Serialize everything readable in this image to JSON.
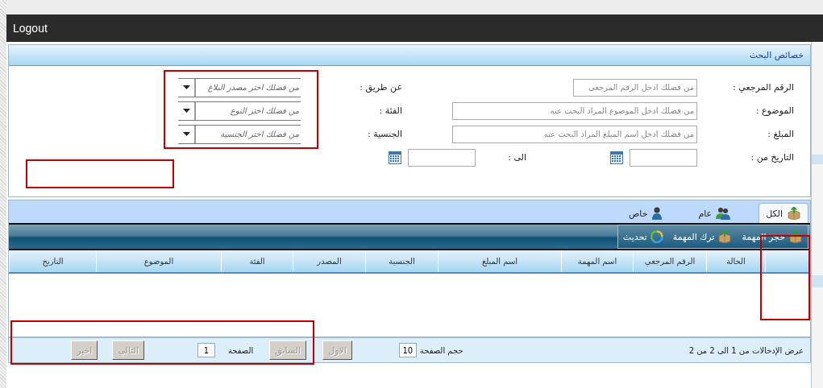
{
  "header": {
    "link": "Logout"
  },
  "search_panel": {
    "title": "خصائص البحث",
    "text_fields": [
      {
        "label": "الرقم المرجعي :",
        "placeholder": "من فضلك ادخل الرقم المرجعي"
      },
      {
        "label": "الموضوع :",
        "placeholder": "من فضلك ادخل الموضوع المراد البحث عنه"
      },
      {
        "label": "المبلغ :",
        "placeholder": "من فضلك ادخل اسم المبلغ المراد البحث عنه"
      }
    ],
    "date_range": {
      "label": "التاريخ من :",
      "to_label": "الى :"
    },
    "selects": [
      {
        "label": "عن طريق :",
        "value": "من فضلك اختر مصدر البلاغ"
      },
      {
        "label": "الفئة :",
        "value": "من فضلك اختر النوع"
      },
      {
        "label": "الجنسية :",
        "value": "من فضلك اختر الجنسية"
      }
    ]
  },
  "tabs": [
    {
      "label": "الكل",
      "selected": true
    },
    {
      "label": "عام",
      "selected": false
    },
    {
      "label": "خاص",
      "selected": false
    }
  ],
  "toolbar": [
    "حجز المهمة",
    "ترك المهمة",
    "تحديث"
  ],
  "table": {
    "columns": [
      "",
      "الحالة",
      "الرقم المرجعي",
      "اسم المهمة",
      "اسم المبلغ",
      "الجنسية",
      "المصدر",
      "الفئة",
      "الموضوع",
      "التاريخ"
    ]
  },
  "pager": {
    "status": "عرض الإدخالات من 1 الى 2 من 2",
    "page_size_label": "حجم الصفحة",
    "page_size": "10",
    "buttons": [
      {
        "label": "الاول",
        "disabled": true
      },
      {
        "label": "السابق",
        "disabled": true
      }
    ],
    "page_label": "الصفحة",
    "page": "1",
    "buttons_after": [
      {
        "label": "التالي",
        "disabled": true
      },
      {
        "label": "اخير",
        "disabled": true
      }
    ]
  }
}
